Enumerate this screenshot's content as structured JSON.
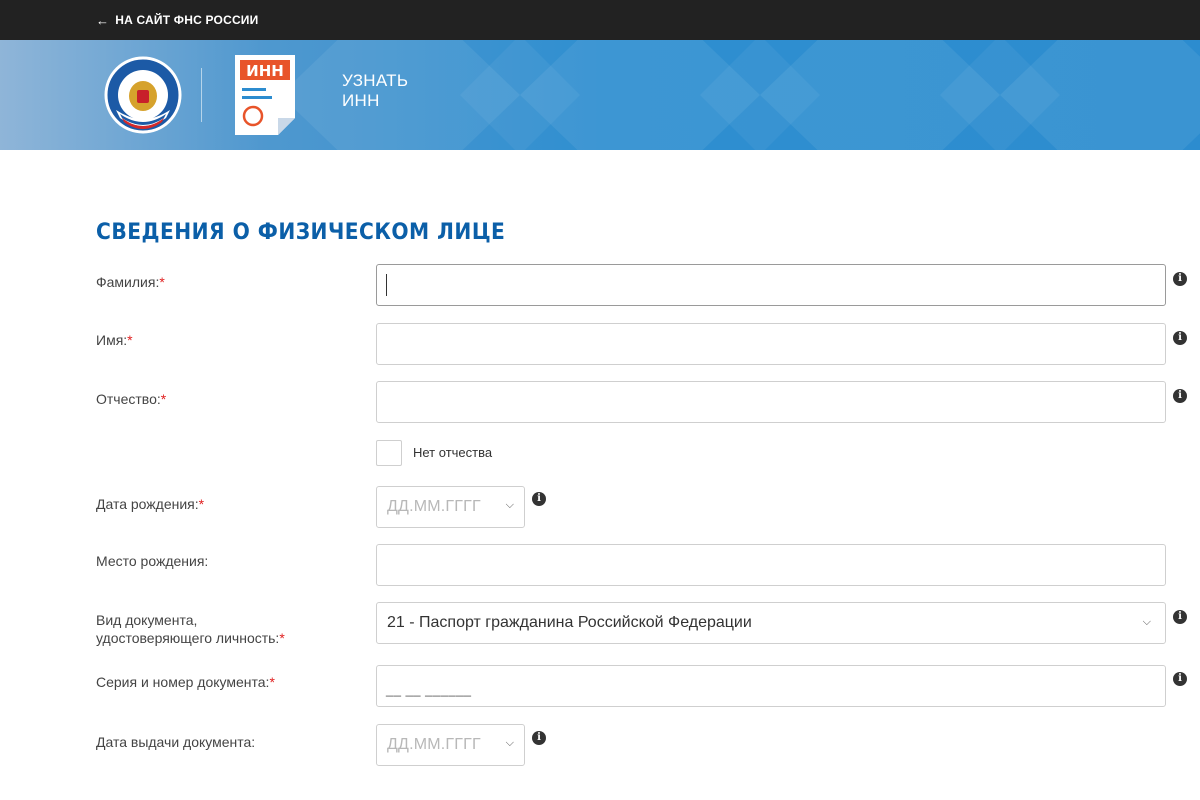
{
  "topbar": {
    "back_label": "НА САЙТ ФНС РОССИИ"
  },
  "banner": {
    "inn_badge": "ИНН",
    "title_line1": "УЗНАТЬ",
    "title_line2": "ИНН"
  },
  "form": {
    "title": "СВЕДЕНИЯ О ФИЗИЧЕСКОМ ЛИЦЕ",
    "required_mark": "*",
    "fields": {
      "surname": {
        "label": "Фамилия:",
        "value": ""
      },
      "name": {
        "label": "Имя:",
        "value": ""
      },
      "patronymic": {
        "label": "Отчество:",
        "value": ""
      },
      "no_patronymic": {
        "label": "Нет отчества",
        "checked": false
      },
      "birth_date": {
        "label": "Дата рождения:",
        "placeholder": "ДД.ММ.ГГГГ"
      },
      "birth_place": {
        "label": "Место рождения:",
        "value": ""
      },
      "doc_type": {
        "label_line1": "Вид документа,",
        "label_line2": "удостоверяющего личность:",
        "value": "21 - Паспорт гражданина Российской Федерации"
      },
      "doc_number": {
        "label": "Серия и номер документа:",
        "mask": "__ __ ______"
      },
      "issue_date": {
        "label": "Дата выдачи документа:",
        "placeholder": "ДД.ММ.ГГГГ"
      }
    }
  },
  "icons": {
    "info": "info-icon",
    "chevron": "chevron-down-icon",
    "back": "arrow-left-icon"
  },
  "colors": {
    "topbar": "#222222",
    "banner": "#2c8ccf",
    "title": "#0b5fa8",
    "required": "#e02020",
    "inn_badge": "#e8542a"
  }
}
